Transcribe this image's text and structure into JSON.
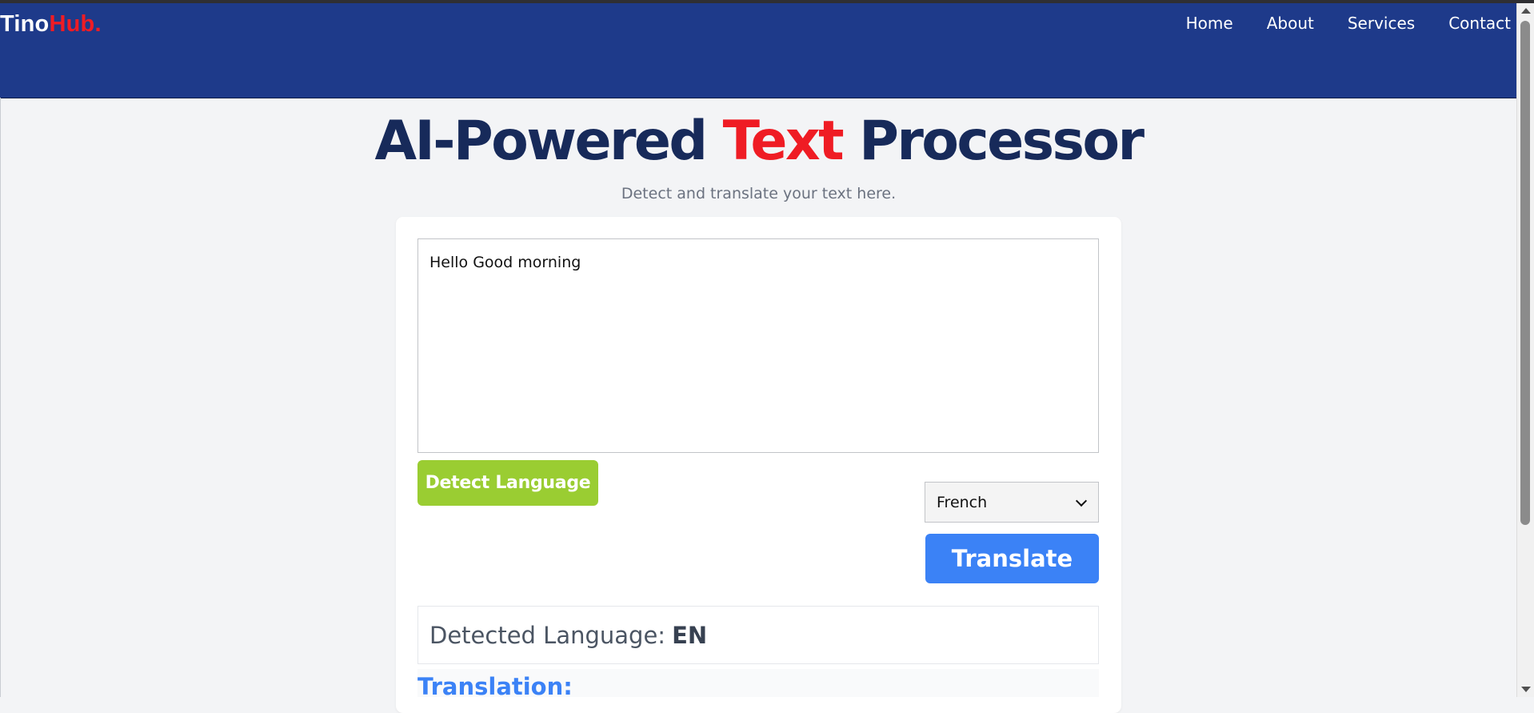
{
  "logo": {
    "text_main": "Tino",
    "text_accent": "Hub."
  },
  "nav": {
    "items": [
      "Home",
      "About",
      "Services",
      "Contact"
    ]
  },
  "hero": {
    "title_part1": "AI-Powered ",
    "title_highlight": "Text",
    "title_part2": " Processor",
    "subtitle": "Detect and translate your text here."
  },
  "input": {
    "value": "Hello Good morning"
  },
  "buttons": {
    "detect": "Detect Language",
    "translate": "Translate"
  },
  "language_select": {
    "selected": "French"
  },
  "result": {
    "detected_label": "Detected Language:",
    "detected_value": "EN",
    "translation_label": "Translation:"
  },
  "colors": {
    "header_bg": "#1e3a8a",
    "title_color": "#172a5a",
    "accent_red": "#ef1c24",
    "detect_button": "#9acd32",
    "translate_button": "#3b82f6"
  }
}
